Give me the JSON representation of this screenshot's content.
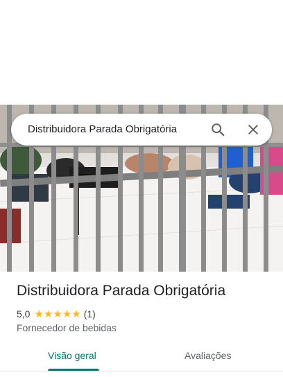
{
  "search": {
    "query": "Distribuidora Parada Obrigatória"
  },
  "place": {
    "name": "Distribuidora Parada Obrigatória",
    "rating": "5,0",
    "stars": 5,
    "review_count": "(1)",
    "category": "Fornecedor de bebidas"
  },
  "tabs": [
    {
      "label": "Visão geral",
      "active": true
    },
    {
      "label": "Avaliações",
      "active": false
    }
  ],
  "icons": {
    "search": "search-icon",
    "close": "close-icon",
    "star": "star-icon"
  },
  "colors": {
    "accent": "#00796b",
    "star": "#fbbc04"
  }
}
